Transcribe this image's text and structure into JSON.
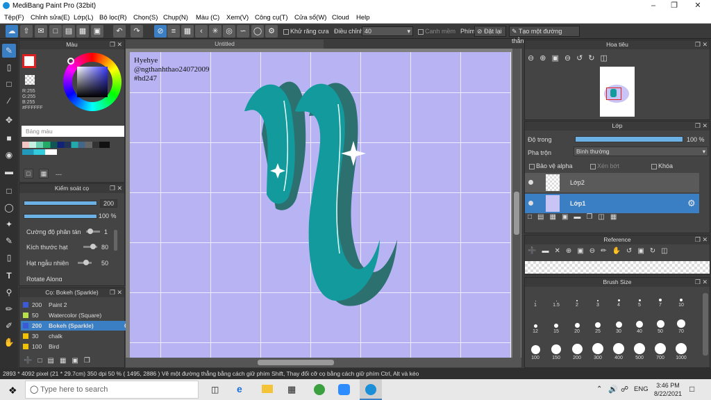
{
  "window": {
    "title": "MediBang Paint Pro (32bit)"
  },
  "menu": [
    "Tệp(F)",
    "Chỉnh sửa(E)",
    "Lớp(L)",
    "Bộ lọc(R)",
    "Chọn(S)",
    "Chụp(N)",
    "Màu (C)",
    "Xem(V)",
    "Công cụ(T)",
    "Cửa sổ(W)",
    "Cloud",
    "Help"
  ],
  "toolbar": {
    "antialias": "Khử răng cưa",
    "correction": "Điều chỉnh",
    "correction_value": "40",
    "edge": "Canh mềm",
    "key": "Phím",
    "reset": "Đặt lại",
    "straight": "Tạo một đường thẳng"
  },
  "color_panel": {
    "title": "Màu",
    "r": "R:255",
    "g": "G:255",
    "b": "B:255",
    "hex": "#FFFFFF",
    "palette_label": "Bảng màu",
    "dash": "---"
  },
  "brush_control": {
    "title": "Kiểm soát cọ",
    "size": "200",
    "opacity": "100 %",
    "scatter_label": "Cường độ phân tán",
    "scatter_val": "1",
    "particle_label": "Kích thước hạt",
    "particle_val": "80",
    "random_label": "Hạt ngẫu nhiên",
    "random_val": "50",
    "rotate_label": "Rotate Along"
  },
  "brush_list": {
    "title": "Cọ: Bokeh (Sparkle)",
    "items": [
      {
        "num": "200",
        "name": "Paint 2",
        "color": "#3c5ad8"
      },
      {
        "num": "50",
        "name": "Watercolor (Square)",
        "color": "#b8e04a"
      },
      {
        "num": "200",
        "name": "Bokeh (Sparkle)",
        "color": "#3c5ad8"
      },
      {
        "num": "30",
        "name": "chalk",
        "color": "#f2c200"
      },
      {
        "num": "100",
        "name": "Bird",
        "color": "#f2c200"
      }
    ]
  },
  "canvas": {
    "tab": "Untitled",
    "text1": "Hyehye",
    "text2": "@ngthanhthao24072009",
    "text3": "#hd247"
  },
  "navigator": {
    "title": "Hoa tiêu"
  },
  "layer_panel": {
    "title": "Lớp",
    "opacity_label": "Độ trong",
    "opacity_val": "100 %",
    "blend_label": "Pha trộn",
    "blend_val": "Bình thường",
    "protect": "Bảo vệ alpha",
    "clip": "Xén bớt",
    "lock": "Khóa",
    "layers": [
      "Lớp2",
      "Lớp1"
    ]
  },
  "reference": {
    "title": "Reference"
  },
  "brush_size": {
    "title": "Brush Size",
    "sizes": [
      "1",
      "1.5",
      "2",
      "3",
      "4",
      "5",
      "7",
      "10",
      "12",
      "15",
      "20",
      "25",
      "30",
      "40",
      "50",
      "70",
      "100",
      "150",
      "200",
      "300",
      "400",
      "500",
      "700",
      "1000"
    ]
  },
  "status": {
    "text": "2893 * 4092 pixel   (21 * 29.7cm)  350 dpi   50 %   ( 1495, 2886 )   Vẽ một đường thẳng bằng cách giữ phím Shift, Thay đổi cỡ cọ bằng cách giữ phím Ctrl, Alt và kéo"
  },
  "taskbar": {
    "search": "Type here to search",
    "time": "3:46 PM",
    "date": "8/22/2021",
    "lang": "ENG"
  },
  "colors": {
    "accent": "#3a7ec4",
    "paper": "#b8b4f4",
    "letter": "#129a9c",
    "shadow": "#2d7070"
  }
}
